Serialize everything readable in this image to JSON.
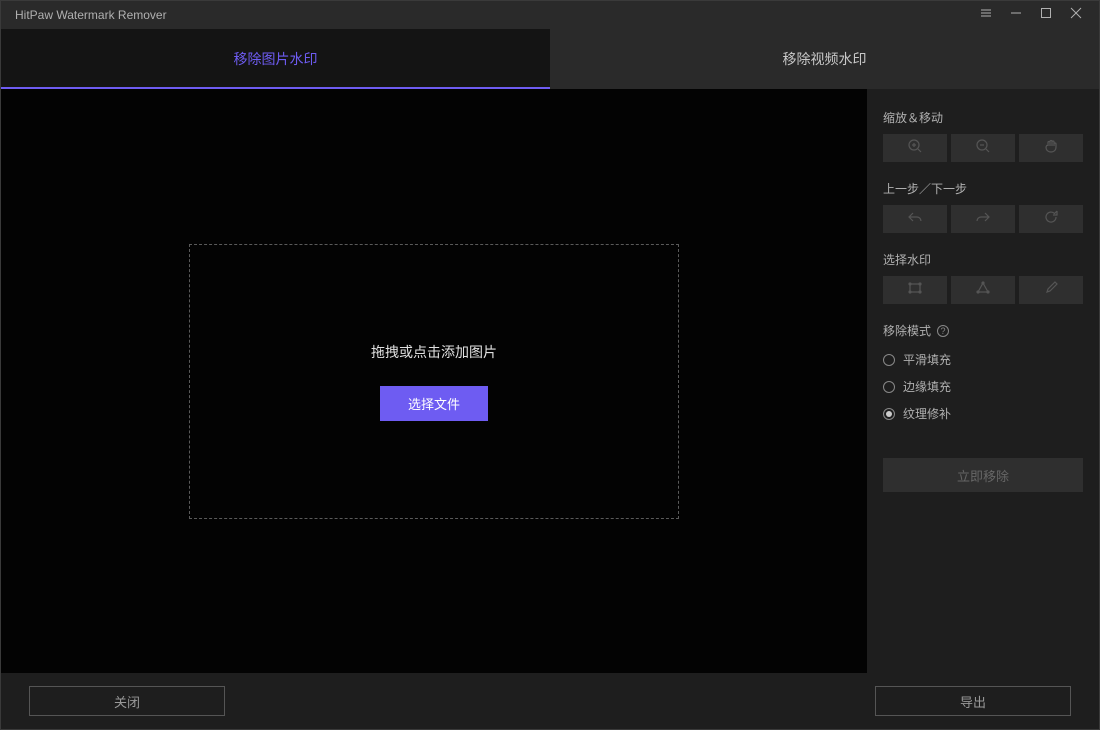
{
  "titlebar": {
    "title": "HitPaw Watermark Remover"
  },
  "tabs": {
    "image": "移除图片水印",
    "video": "移除视频水印"
  },
  "dropzone": {
    "hint": "拖拽或点击添加图片",
    "select_btn": "选择文件"
  },
  "sidebar": {
    "zoom_title": "缩放＆移动",
    "undo_title": "上一步／下一步",
    "select_title": "选择水印",
    "mode_title": "移除模式",
    "modes": {
      "smooth": "平滑填充",
      "edge": "边缘填充",
      "texture": "纹理修补"
    },
    "selected_mode": "texture",
    "remove_now": "立即移除"
  },
  "footer": {
    "close": "关闭",
    "export": "导出"
  }
}
